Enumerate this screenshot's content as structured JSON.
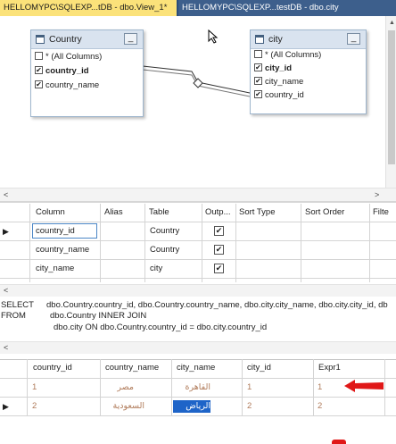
{
  "tabs": [
    {
      "label": "HELLOMYPC\\SQLEXP...tDB - dbo.View_1*"
    },
    {
      "label": "HELLOMYPC\\SQLEXP...testDB - dbo.city"
    }
  ],
  "diagram": {
    "country_table": {
      "title": "Country",
      "columns": [
        {
          "label": "* (All Columns)",
          "checked": false
        },
        {
          "label": "country_id",
          "checked": true,
          "bold": true
        },
        {
          "label": "country_name",
          "checked": true,
          "bold": false
        }
      ]
    },
    "city_table": {
      "title": "city",
      "columns": [
        {
          "label": "* (All Columns)",
          "checked": false
        },
        {
          "label": "city_id",
          "checked": true,
          "bold": true
        },
        {
          "label": "city_name",
          "checked": true,
          "bold": false
        },
        {
          "label": "country_id",
          "checked": true,
          "bold": false
        }
      ]
    },
    "minimize_glyph": "_",
    "check_glyph": "✔"
  },
  "criteria": {
    "headers": [
      "Column",
      "Alias",
      "Table",
      "Outp...",
      "Sort Type",
      "Sort Order",
      "Filte"
    ],
    "rows": [
      {
        "column": "country_id",
        "alias": "",
        "table": "Country",
        "output": true
      },
      {
        "column": "country_name",
        "alias": "",
        "table": "Country",
        "output": true
      },
      {
        "column": "city_name",
        "alias": "",
        "table": "city",
        "output": true
      }
    ]
  },
  "sql": {
    "select_kw": "SELECT",
    "select_text": "dbo.Country.country_id, dbo.Country.country_name, dbo.city.city_name, dbo.city.city_id, db",
    "from_kw": "FROM",
    "from_line1": "dbo.Country INNER JOIN",
    "from_line2": "dbo.city ON dbo.Country.country_id = dbo.city.country_id"
  },
  "results": {
    "headers": [
      "country_id",
      "country_name",
      "city_name",
      "city_id",
      "Expr1"
    ],
    "rows": [
      {
        "country_id": "1",
        "country_name": "مصر",
        "city_name": "القاهرة",
        "city_id": "1",
        "expr1": "1"
      },
      {
        "country_id": "2",
        "country_name": "السعودية",
        "city_name": "الرياض",
        "city_id": "2",
        "expr1": "2"
      }
    ]
  },
  "colors": {
    "tab_active": "#fbe27a",
    "tab_bar": "#2b4d7a",
    "selection": "#1e64c8",
    "annotation_arrow": "#e01818"
  }
}
